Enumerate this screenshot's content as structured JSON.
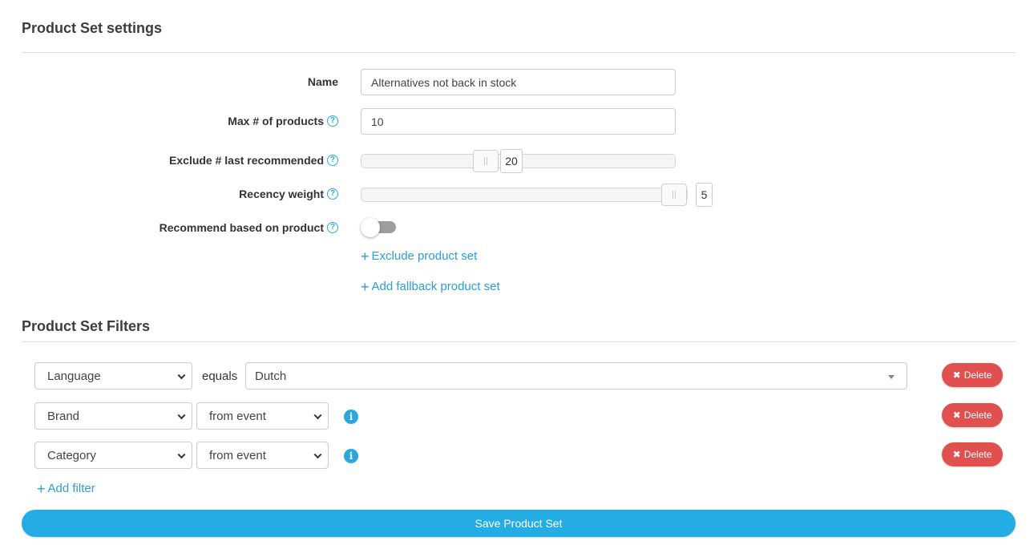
{
  "settings": {
    "title": "Product Set settings",
    "name_label": "Name",
    "name_value": "Alternatives not back in stock",
    "max_label": "Max # of products",
    "max_value": "10",
    "exclude_label": "Exclude # last recommended",
    "exclude_value": "20",
    "exclude_level": 0.35,
    "recency_label": "Recency weight",
    "recency_value": "5",
    "recency_level": 1.0,
    "recommend_label": "Recommend based on product",
    "recommend_on": false,
    "help_glyph": "?",
    "exclude_set_link": "Exclude product set",
    "fallback_set_link": "Add fallback product set",
    "plus_glyph": "+"
  },
  "filters": {
    "title": "Product Set Filters",
    "rows": [
      {
        "field": "Language",
        "operator": "equals",
        "value": "Dutch"
      },
      {
        "field": "Brand",
        "operator": "from event"
      },
      {
        "field": "Category",
        "operator": "from event"
      }
    ],
    "info_glyph": "i",
    "delete_label": "Delete",
    "delete_glyph": "✖",
    "add_filter_link": "Add filter"
  },
  "save_label": "Save Product Set",
  "icons": {
    "help": "question-circle-icon",
    "info": "info-circle-icon",
    "plus": "plus-icon",
    "delete": "close-icon",
    "select": "chevron-down-icon"
  },
  "colors": {
    "accent": "#29a8e0",
    "danger": "#e0504f",
    "save": "#24ade4"
  }
}
